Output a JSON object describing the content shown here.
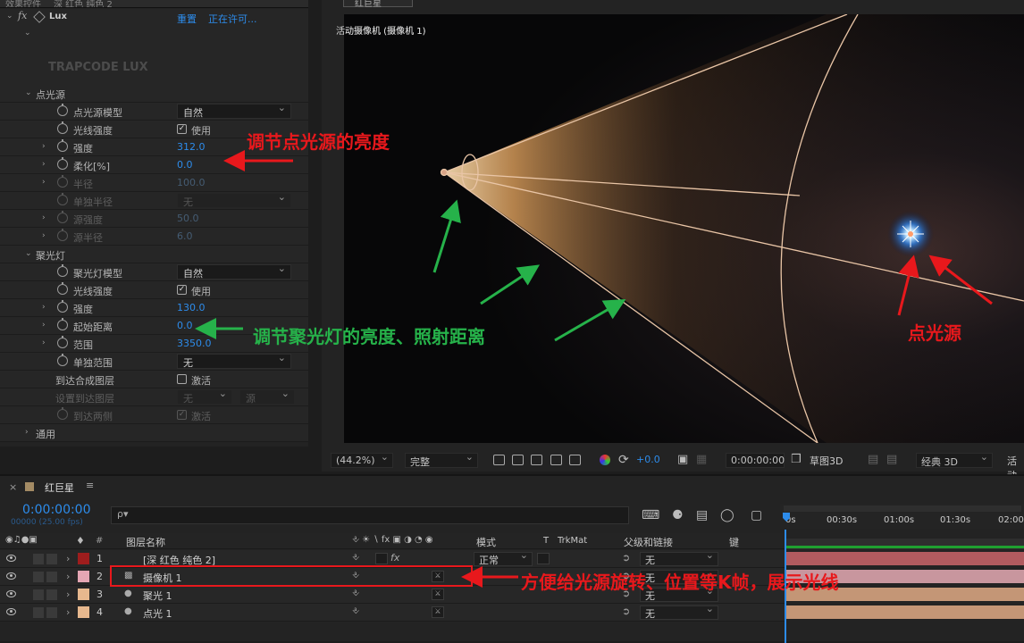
{
  "effects": {
    "top_tabs": [
      "效果控件",
      "深 红色 纯色 2"
    ],
    "effect_name": "Lux",
    "reset": "重置",
    "licensing": "正在许可...",
    "logo": "TRAPCODE LUX",
    "point_section": "点光源",
    "point_props": [
      {
        "label": "点光源模型",
        "kind": "drop",
        "value": "自然"
      },
      {
        "label": "光线强度",
        "kind": "check",
        "value": "使用"
      },
      {
        "label": "强度",
        "kind": "num",
        "value": "312.0"
      },
      {
        "label": "柔化[%]",
        "kind": "num",
        "value": "0.0"
      },
      {
        "label": "半径",
        "kind": "num",
        "value": "100.0",
        "dim": true
      },
      {
        "label": "单独半径",
        "kind": "drop",
        "value": "无",
        "dim": true
      },
      {
        "label": "源强度",
        "kind": "num",
        "value": "50.0",
        "dim": true
      },
      {
        "label": "源半径",
        "kind": "num",
        "value": "6.0",
        "dim": true
      }
    ],
    "spot_section": "聚光灯",
    "spot_props": [
      {
        "label": "聚光灯模型",
        "kind": "drop",
        "value": "自然"
      },
      {
        "label": "光线强度",
        "kind": "check",
        "value": "使用"
      },
      {
        "label": "强度",
        "kind": "num",
        "value": "130.0"
      },
      {
        "label": "起始距离",
        "kind": "num",
        "value": "0.0"
      },
      {
        "label": "范围",
        "kind": "num",
        "value": "3350.0"
      },
      {
        "label": "单独范围",
        "kind": "drop",
        "value": "无"
      }
    ],
    "to_comp_layer": {
      "label": "到达合成图层",
      "value": "激活"
    },
    "set_to_layer": {
      "label": "设置到达图层",
      "value1": "无",
      "value2": "源"
    },
    "to_back": {
      "label": "到达两侧",
      "value": "激活"
    },
    "general": "通用"
  },
  "viewer": {
    "tab": "红巨星",
    "camera_label": "活动摄像机 (摄像机 1)",
    "zoom": "(44.2%)",
    "quality": "完整",
    "exposure": "+0.0",
    "timecode": "0:00:00:00",
    "draft3d": "草图3D",
    "renderer": "经典 3D",
    "active_cut": "活动"
  },
  "timeline": {
    "comp_name": "红巨星",
    "timecode": "0:00:00:00",
    "frames": "00000 (25.00 fps)",
    "search_placeholder": "ρ▾",
    "col_layer_name": "图层名称",
    "col_mode": "模式",
    "col_t": "T",
    "col_trkmat": "TrkMat",
    "col_parent": "父级和链接",
    "col_key": "键",
    "ruler": [
      "0s",
      "00:30s",
      "01:00s",
      "01:30s",
      "02:00"
    ],
    "layers": [
      {
        "num": "1",
        "name": "[深 红色 纯色 2]",
        "color": "#9e1d1d",
        "mode": "正常",
        "parent": "无",
        "bar": "#b15b5f"
      },
      {
        "num": "2",
        "name": "摄像机 1",
        "color": "#e5a6b4",
        "mode": "",
        "parent": "无",
        "bar": "#c8969e"
      },
      {
        "num": "3",
        "name": "聚光 1",
        "color": "#e7b88e",
        "mode": "",
        "parent": "无",
        "bar": "#c49676"
      },
      {
        "num": "4",
        "name": "点光 1",
        "color": "#e7b88e",
        "mode": "",
        "parent": "无",
        "bar": "#c49676"
      }
    ]
  },
  "annotations": {
    "point_intensity": "调节点光源的亮度",
    "spot_intensity": "调节聚光灯的亮度、照射距离",
    "point_source": "点光源",
    "camera_note": "方便给光源旋转、位置等K帧，展示光线"
  }
}
